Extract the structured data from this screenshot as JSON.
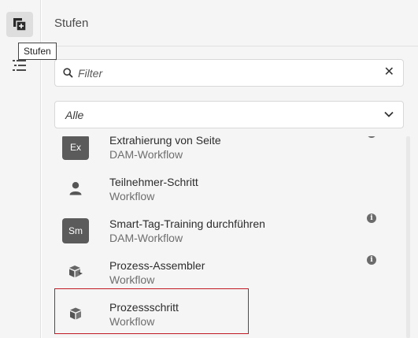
{
  "rail": {
    "items": [
      {
        "name": "stages-panel-button",
        "icon": "add-layers-icon",
        "active": true
      },
      {
        "name": "tree-list-button",
        "icon": "list-tree-icon",
        "active": false
      }
    ],
    "tooltip": "Stufen"
  },
  "panel": {
    "title": "Stufen",
    "filter": {
      "placeholder": "Filter",
      "clear_label": "✕"
    },
    "select": {
      "value": "Alle"
    },
    "items": [
      {
        "title": "Extrahierung von Seite",
        "subtitle": "DAM-Workflow",
        "icon_text": "Ex",
        "icon": "ex-badge-icon",
        "info": true
      },
      {
        "title": "Teilnehmer-Schritt",
        "subtitle": "Workflow",
        "icon": "user-icon",
        "info": false
      },
      {
        "title": "Smart-Tag-Training durchführen",
        "subtitle": "DAM-Workflow",
        "icon_text": "Sm",
        "icon": "sm-badge-icon",
        "info": true
      },
      {
        "title": "Prozess-Assembler",
        "subtitle": "Workflow",
        "icon": "assembler-box-icon",
        "info": true
      },
      {
        "title": "Prozessschritt",
        "subtitle": "Workflow",
        "icon": "box-icon",
        "info": false,
        "highlighted": true
      }
    ]
  },
  "colors": {
    "highlight": "#c21a24",
    "panel_bg": "#f5f5f5",
    "badge_bg": "#5b5b5b"
  }
}
